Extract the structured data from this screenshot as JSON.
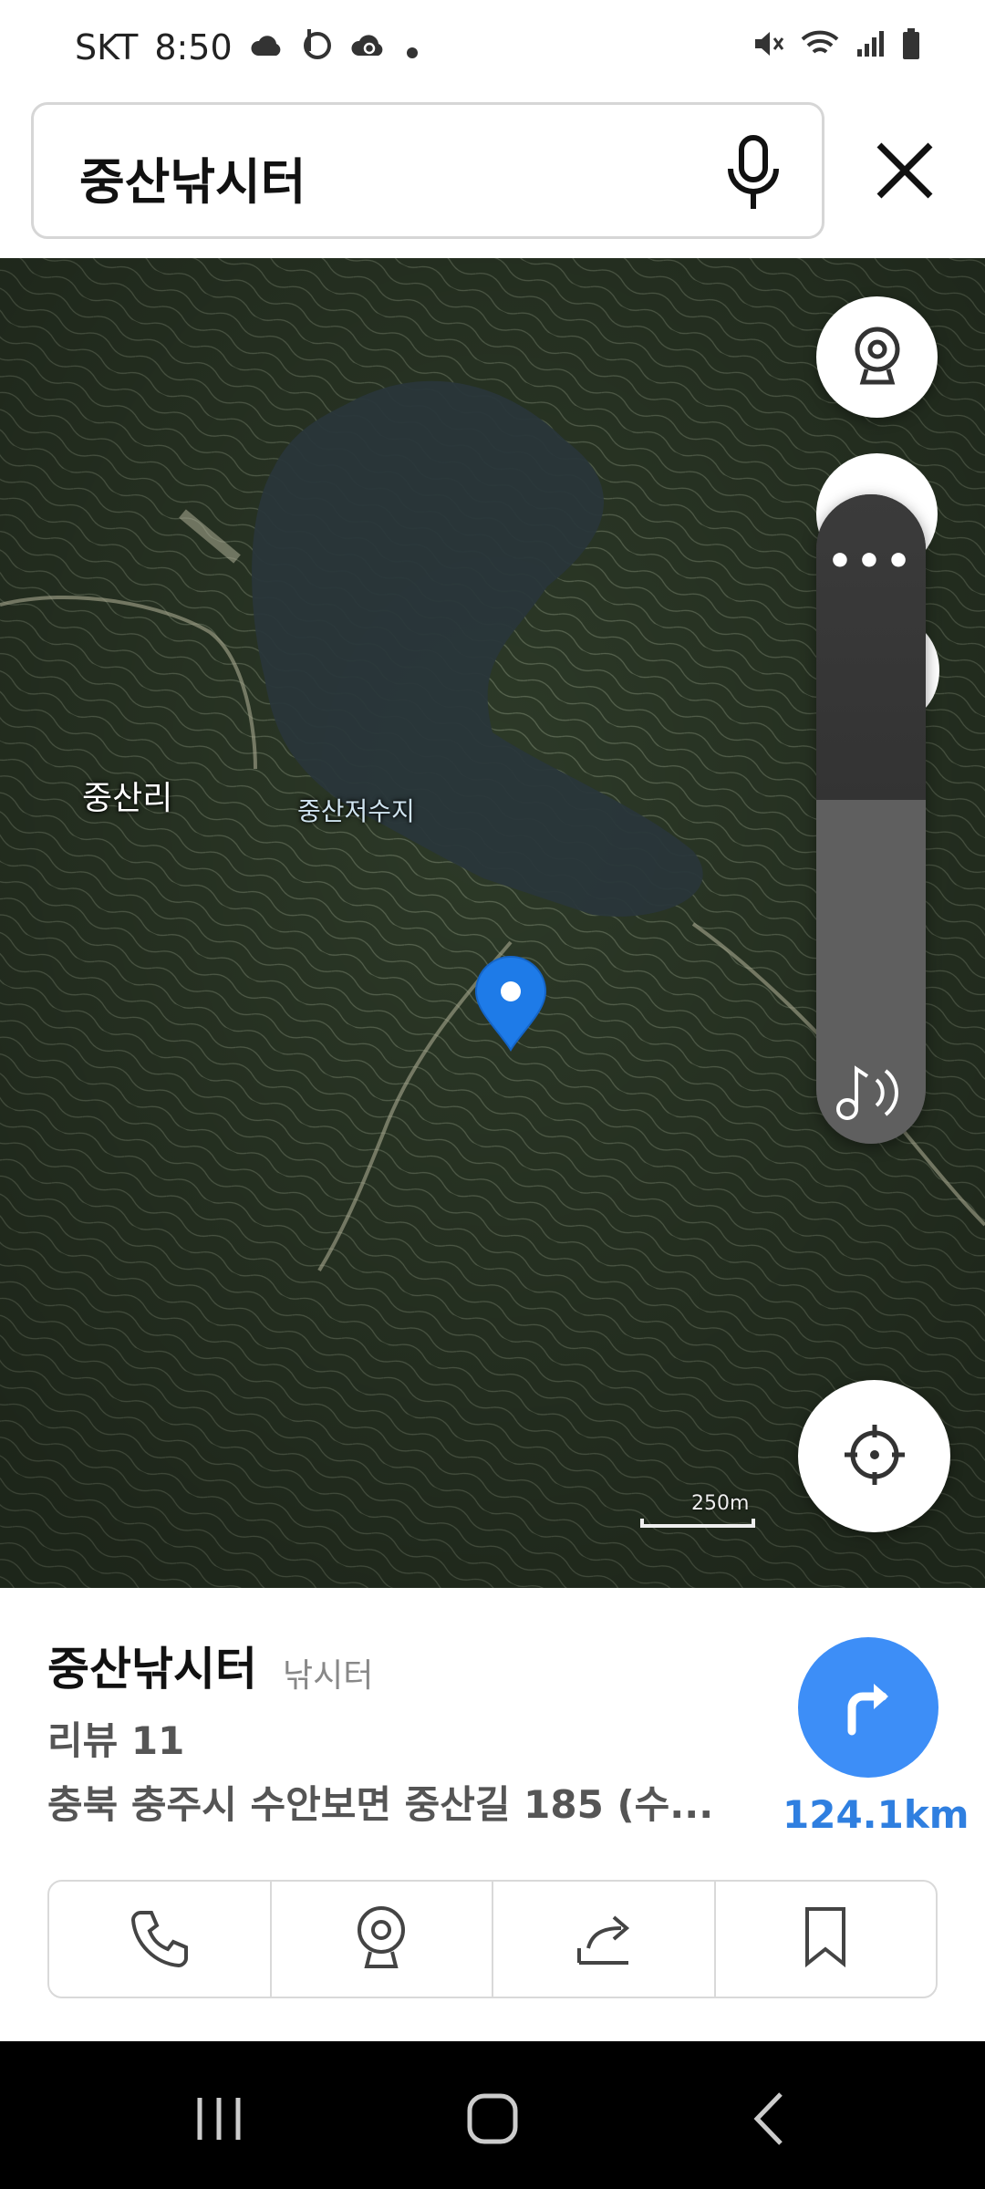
{
  "status_bar": {
    "carrier": "SKT",
    "time": "8:50",
    "icons_left": [
      "cloud-icon",
      "b-icon",
      "cloud-sync-icon",
      "dot-icon"
    ],
    "icons_right": [
      "mute-icon",
      "wifi-icon",
      "signal-icon",
      "battery-icon"
    ]
  },
  "search": {
    "query": "중산낚시터",
    "mic_icon": "microphone-icon",
    "close_icon": "close-icon"
  },
  "map": {
    "labels": {
      "village": "중산리",
      "reservoir": "중산저수지"
    },
    "scale_label": "250m",
    "pin_color": "#1e7be8"
  },
  "volume_panel": {
    "more_label": "•••",
    "level_percent": 53
  },
  "place": {
    "name": "중산낚시터",
    "category": "낚시터",
    "review": "리뷰 11",
    "address": "충북 충주시 수안보면 중산길 185 (수...",
    "distance": "124.1km"
  },
  "actions": [
    "phone-icon",
    "cctv-icon",
    "share-icon",
    "bookmark-icon"
  ],
  "colors": {
    "accent": "#3d8ef7",
    "distance_text": "#2f7fe0"
  }
}
